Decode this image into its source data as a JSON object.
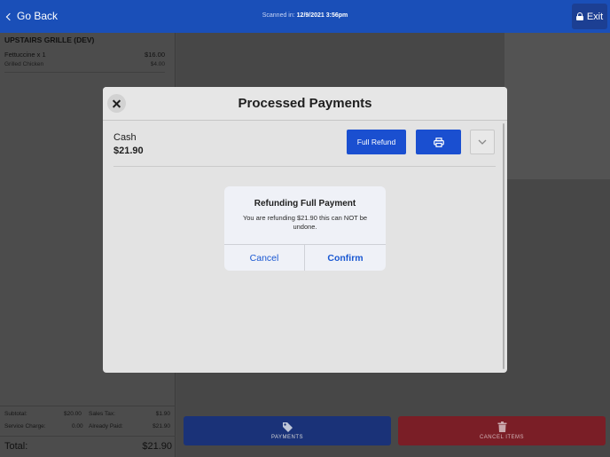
{
  "header": {
    "back_label": "Go Back",
    "scanned_prefix": "Scanned in:",
    "scanned_datetime": "12/9/2021 3:56pm",
    "exit_label": "Exit"
  },
  "order": {
    "venue": "UPSTAIRS GRILLE (DEV)",
    "items": [
      {
        "name": "Fettuccine x 1",
        "price": "$16.00"
      },
      {
        "name": "Grilled Chicken",
        "price": "$4.00"
      }
    ],
    "summary": {
      "subtotal_label": "Subtotal:",
      "subtotal_value": "$20.00",
      "sales_tax_label": "Sales Tax:",
      "sales_tax_value": "$1.90",
      "service_charge_label": "Service Charge:",
      "service_charge_value": "0.00",
      "already_paid_label": "Already Paid:",
      "already_paid_value": "$21.90",
      "total_label": "Total:",
      "total_value": "$21.90"
    }
  },
  "actions": {
    "payments_label": "PAYMENTS",
    "cancel_items_label": "CANCEL ITEMS"
  },
  "modal": {
    "title": "Processed Payments",
    "payment": {
      "type": "Cash",
      "amount": "$21.90",
      "full_refund_label": "Full Refund"
    }
  },
  "alert": {
    "title": "Refunding Full Payment",
    "message": "You are refunding $21.90 this can NOT be undone.",
    "cancel_label": "Cancel",
    "confirm_label": "Confirm"
  },
  "colors": {
    "brand_blue": "#1a4fb8",
    "action_blue": "#1a4fd0",
    "danger_red": "#d52b39"
  },
  "icons": {
    "back": "chevron-left-icon",
    "exit": "lock-icon",
    "close": "close-icon",
    "print": "printer-icon",
    "expand": "chevron-down-icon",
    "payments": "tag-icon",
    "cancel_items": "trash-icon"
  }
}
